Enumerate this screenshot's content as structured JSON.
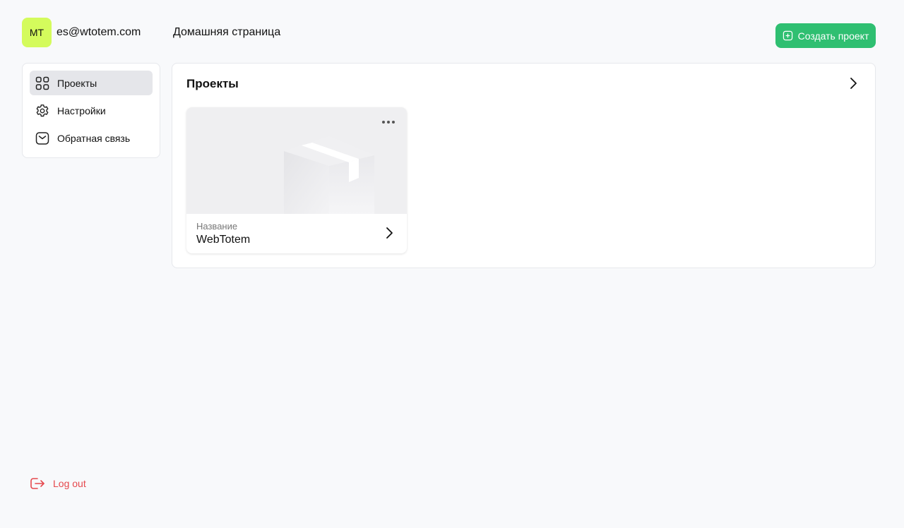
{
  "user": {
    "initials": "MT",
    "email": "es@wtotem.com",
    "avatar_color": "#d4fb5c"
  },
  "header": {
    "page_title": "Домашняя страница",
    "create_button_label": "Создать проект",
    "create_button_icon": "plus-square-icon",
    "accent_color": "#2fbf71"
  },
  "sidebar": {
    "items": [
      {
        "label": "Проекты",
        "icon": "grid-icon",
        "active": true
      },
      {
        "label": "Настройки",
        "icon": "gear-icon",
        "active": false
      },
      {
        "label": "Обратная связь",
        "icon": "mail-icon",
        "active": false
      }
    ]
  },
  "main": {
    "section_title": "Проекты",
    "projects": [
      {
        "name_label": "Название",
        "name": "WebTotem",
        "thumbnail": "box-placeholder"
      }
    ]
  },
  "footer": {
    "logout_label": "Log out",
    "logout_color": "#e5484d"
  }
}
